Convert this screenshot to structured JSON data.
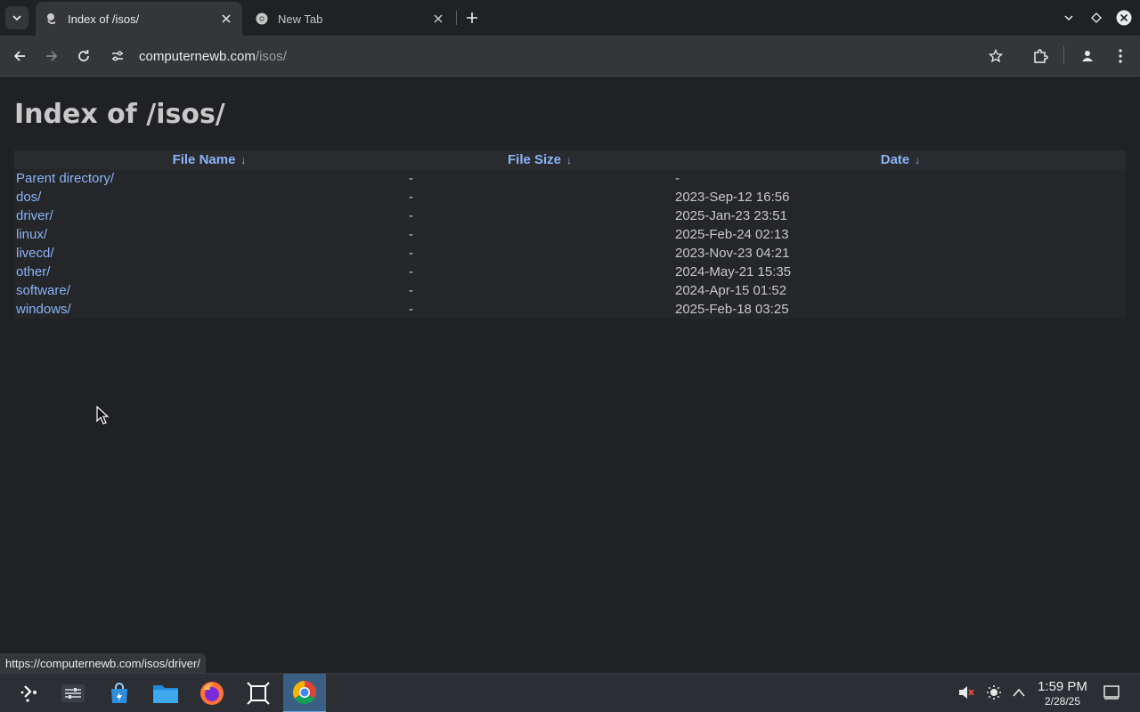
{
  "browser": {
    "tabs": [
      {
        "title": "Index of /isos/",
        "active": true,
        "favicon": "site-favicon"
      },
      {
        "title": "New Tab",
        "active": false,
        "favicon": "chrome-icon"
      }
    ],
    "url": {
      "host": "computernewb.com",
      "path": "/isos/"
    }
  },
  "page": {
    "heading": "Index of /isos/",
    "columns": [
      {
        "label": "File Name",
        "arrow": "↓"
      },
      {
        "label": "File Size",
        "arrow": "↓"
      },
      {
        "label": "Date",
        "arrow": "↓"
      }
    ],
    "rows": [
      {
        "name": "Parent directory/",
        "size": "-",
        "date": "-"
      },
      {
        "name": "dos/",
        "size": "-",
        "date": "2023-Sep-12 16:56"
      },
      {
        "name": "driver/",
        "size": "-",
        "date": "2025-Jan-23 23:51"
      },
      {
        "name": "linux/",
        "size": "-",
        "date": "2025-Feb-24 02:13"
      },
      {
        "name": "livecd/",
        "size": "-",
        "date": "2023-Nov-23 04:21"
      },
      {
        "name": "other/",
        "size": "-",
        "date": "2024-May-21 15:35"
      },
      {
        "name": "software/",
        "size": "-",
        "date": "2024-Apr-15 01:52"
      },
      {
        "name": "windows/",
        "size": "-",
        "date": "2025-Feb-18 03:25"
      }
    ]
  },
  "status_bar": {
    "link": "https://computernewb.com/isos/driver/"
  },
  "taskbar": {
    "apps": [
      "launcher-icon",
      "settings-icon",
      "store-icon",
      "files-icon",
      "firefox-icon",
      "screenshot-tool-icon",
      "chrome-icon"
    ],
    "active_app": "chrome-icon",
    "clock": {
      "time": "1:59 PM",
      "date": "2/28/25"
    }
  },
  "colors": {
    "link": "#8ab4f8",
    "background": "#202124",
    "taskbar_active": "#3a5f85"
  }
}
